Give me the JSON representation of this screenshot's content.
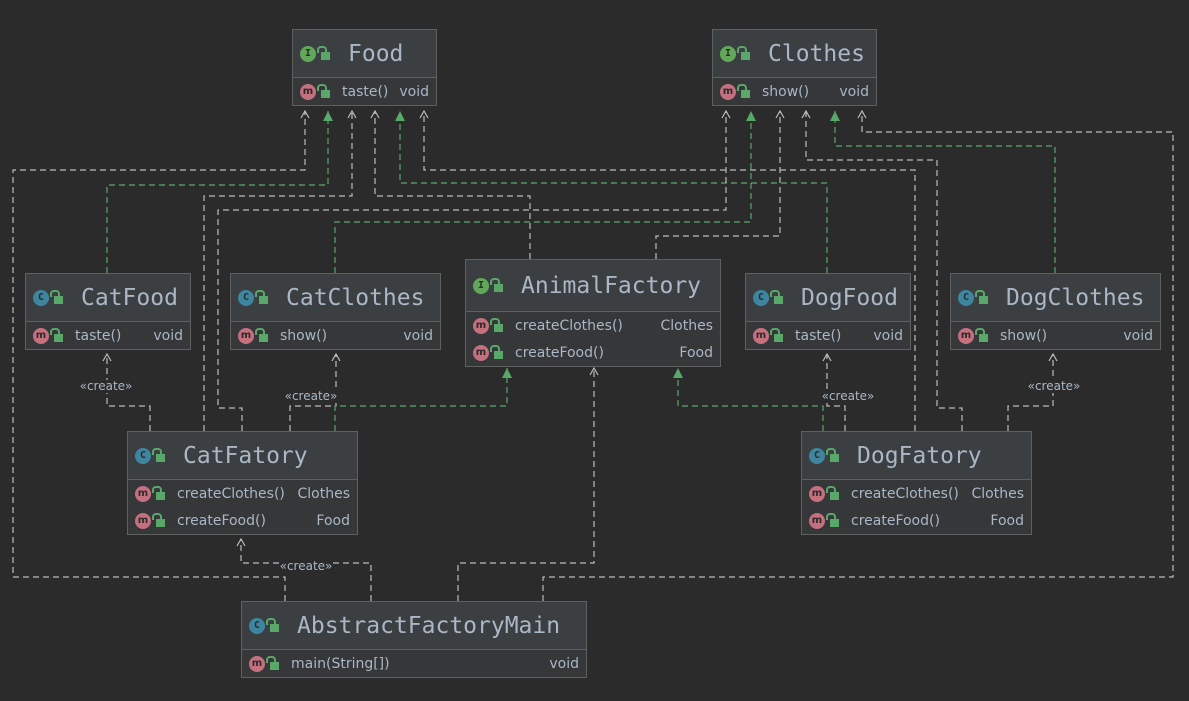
{
  "classes": {
    "food": {
      "name": "Food",
      "kind": "I",
      "members": [
        {
          "name": "taste()",
          "type": "void"
        }
      ]
    },
    "clothes": {
      "name": "Clothes",
      "kind": "I",
      "members": [
        {
          "name": "show()",
          "type": "void"
        }
      ]
    },
    "catfood": {
      "name": "CatFood",
      "kind": "C",
      "members": [
        {
          "name": "taste()",
          "type": "void"
        }
      ]
    },
    "catclothes": {
      "name": "CatClothes",
      "kind": "C",
      "members": [
        {
          "name": "show()",
          "type": "void"
        }
      ]
    },
    "animalfactory": {
      "name": "AnimalFactory",
      "kind": "I",
      "members": [
        {
          "name": "createClothes()",
          "type": "Clothes"
        },
        {
          "name": "createFood()",
          "type": "Food"
        }
      ]
    },
    "dogfood": {
      "name": "DogFood",
      "kind": "C",
      "members": [
        {
          "name": "taste()",
          "type": "void"
        }
      ]
    },
    "dogclothes": {
      "name": "DogClothes",
      "kind": "C",
      "members": [
        {
          "name": "show()",
          "type": "void"
        }
      ]
    },
    "catfatory": {
      "name": "CatFatory",
      "kind": "C",
      "members": [
        {
          "name": "createClothes()",
          "type": "Clothes"
        },
        {
          "name": "createFood()",
          "type": "Food"
        }
      ]
    },
    "dogfatory": {
      "name": "DogFatory",
      "kind": "C",
      "members": [
        {
          "name": "createClothes()",
          "type": "Clothes"
        },
        {
          "name": "createFood()",
          "type": "Food"
        }
      ]
    },
    "main": {
      "name": "AbstractFactoryMain",
      "kind": "C",
      "members": [
        {
          "name": "main(String[])",
          "type": "void"
        }
      ]
    }
  },
  "edge_label": "«create»",
  "colors": {
    "dependency": "#bbbbbb",
    "realization": "#59a869",
    "interface_icon": "#62a85a",
    "class_icon": "#3e86a0",
    "method_icon": "#c4707f"
  }
}
